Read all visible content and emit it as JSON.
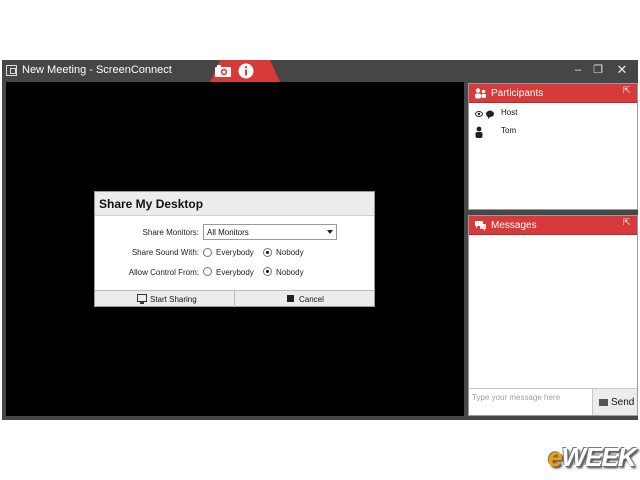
{
  "window": {
    "title": "New Meeting - ScreenConnect",
    "controls": {
      "minimize": "–",
      "maximize": "❐",
      "close": "✕"
    }
  },
  "toolbar": {
    "icons": [
      "camera-icon",
      "info-icon"
    ],
    "accent_color": "#d63a3a"
  },
  "dialog": {
    "title": "Share My Desktop",
    "share_monitors_label": "Share Monitors:",
    "share_monitors_value": "All Monitors",
    "share_sound_label": "Share Sound With:",
    "allow_control_label": "Allow Control From:",
    "option_everybody": "Everybody",
    "option_nobody": "Nobody",
    "share_sound_selected": "Nobody",
    "allow_control_selected": "Nobody",
    "start_button": "Start Sharing",
    "cancel_button": "Cancel"
  },
  "participants": {
    "title": "Participants",
    "items": [
      {
        "name": "Host",
        "icon": "host-icon"
      },
      {
        "name": "Tom",
        "icon": "user-icon"
      }
    ]
  },
  "messages": {
    "title": "Messages",
    "input_placeholder": "Type your message here",
    "send_button": "Send"
  },
  "logo": {
    "prefix": "e",
    "rest": "WEEK",
    "prefix_color": "#f4a000"
  }
}
